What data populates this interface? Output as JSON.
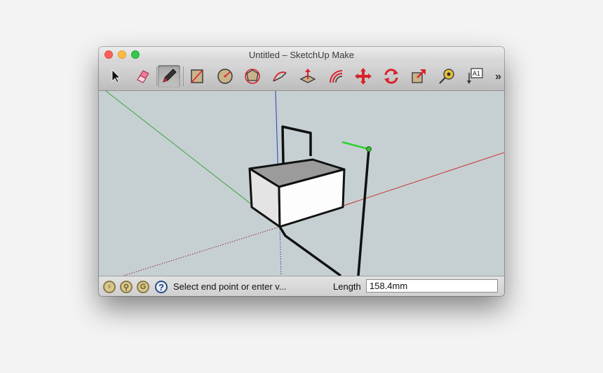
{
  "window": {
    "title": "Untitled – SketchUp Make"
  },
  "toolbar": {
    "tools": [
      {
        "name": "select",
        "icon": "arrow-cursor-icon"
      },
      {
        "name": "eraser",
        "icon": "eraser-icon"
      },
      {
        "name": "line",
        "icon": "pencil-icon",
        "active": true
      },
      {
        "name": "rectangle",
        "icon": "rectangle-icon"
      },
      {
        "name": "circle",
        "icon": "circle-icon"
      },
      {
        "name": "polygon",
        "icon": "polygon-icon"
      },
      {
        "name": "arc",
        "icon": "arc-icon"
      },
      {
        "name": "push-pull",
        "icon": "push-pull-icon"
      },
      {
        "name": "offset",
        "icon": "offset-icon"
      },
      {
        "name": "move",
        "icon": "move-icon"
      },
      {
        "name": "rotate",
        "icon": "rotate-icon"
      },
      {
        "name": "scale",
        "icon": "scale-icon"
      },
      {
        "name": "tape-measure",
        "icon": "tape-measure-icon"
      },
      {
        "name": "text",
        "icon": "text-icon",
        "label": "A1"
      }
    ],
    "overflow": "»"
  },
  "colors": {
    "viewport_bg": "#c6d0d3",
    "x_axis": "#c8332f",
    "y_axis": "#39a53a",
    "z_axis": "#2c3fa8",
    "tool_accent": "#d8222b"
  },
  "statusbar": {
    "icons": [
      "geolocation-icon",
      "credits-icon",
      "user-icon",
      "help-icon"
    ],
    "message": "Select end point or enter v...",
    "length_label": "Length",
    "length_value": "158.4mm"
  }
}
